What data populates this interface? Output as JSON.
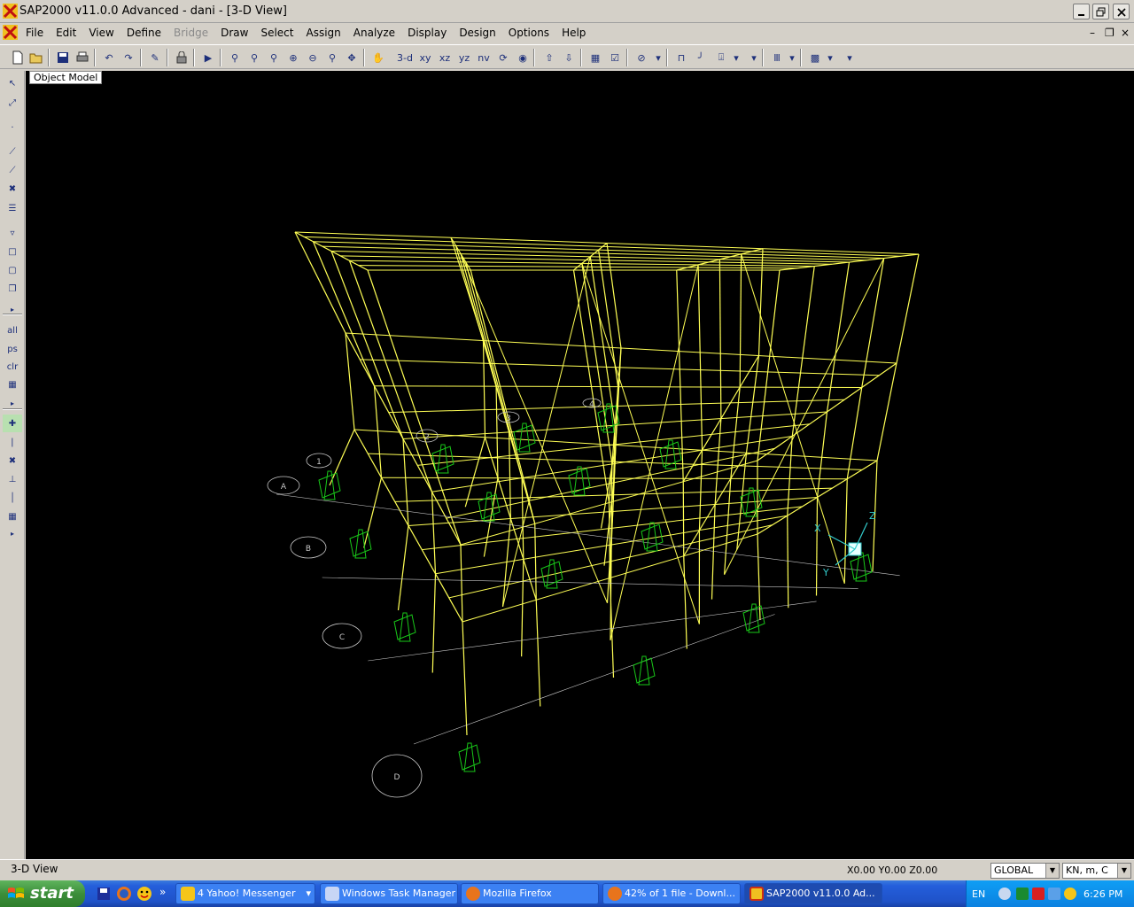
{
  "titlebar": {
    "title": "SAP2000 v11.0.0 Advanced  - dani - [3-D View]"
  },
  "menu": [
    "File",
    "Edit",
    "View",
    "Define",
    "Bridge",
    "Draw",
    "Select",
    "Assign",
    "Analyze",
    "Display",
    "Design",
    "Options",
    "Help"
  ],
  "menu_disabled": [
    "Bridge"
  ],
  "toolbar": {
    "view_3d": "3-d",
    "view_xy": "xy",
    "view_xz": "xz",
    "view_yz": "yz",
    "view_nv": "nv"
  },
  "lefttoolbar": {
    "sel_all": "all",
    "sel_ps": "ps",
    "sel_clr": "clr"
  },
  "viewport": {
    "label": "Object Model",
    "background": "#000000",
    "frame_color": "#ffff55",
    "support_color": "#19c819",
    "grid_color": "#c8c8c8",
    "axis_color": "#33cccc",
    "grid_bubbles": [
      "A",
      "B",
      "C",
      "D",
      "1",
      "2",
      "3",
      "4"
    ],
    "axis_labels": {
      "x": "X",
      "y": "Y",
      "z": "Z"
    }
  },
  "status": {
    "view_name": "3-D View",
    "coords": "X0.00  Y0.00  Z0.00",
    "coord_system": "GLOBAL",
    "units": "KN, m, C"
  },
  "taskbar": {
    "start": "start",
    "tasks": [
      {
        "label": "4 Yahoo! Messenger",
        "icon_color": "#f5c518"
      },
      {
        "label": "Windows Task Manager",
        "icon_color": "#c8d6f5"
      },
      {
        "label": "Mozilla Firefox",
        "icon_color": "#e8741c"
      },
      {
        "label": "42% of 1 file - Downl...",
        "icon_color": "#e8741c"
      },
      {
        "label": "SAP2000 v11.0.0 Ad...",
        "icon_color": "#d03010"
      }
    ],
    "lang": "EN",
    "clock": "6:26 PM"
  }
}
